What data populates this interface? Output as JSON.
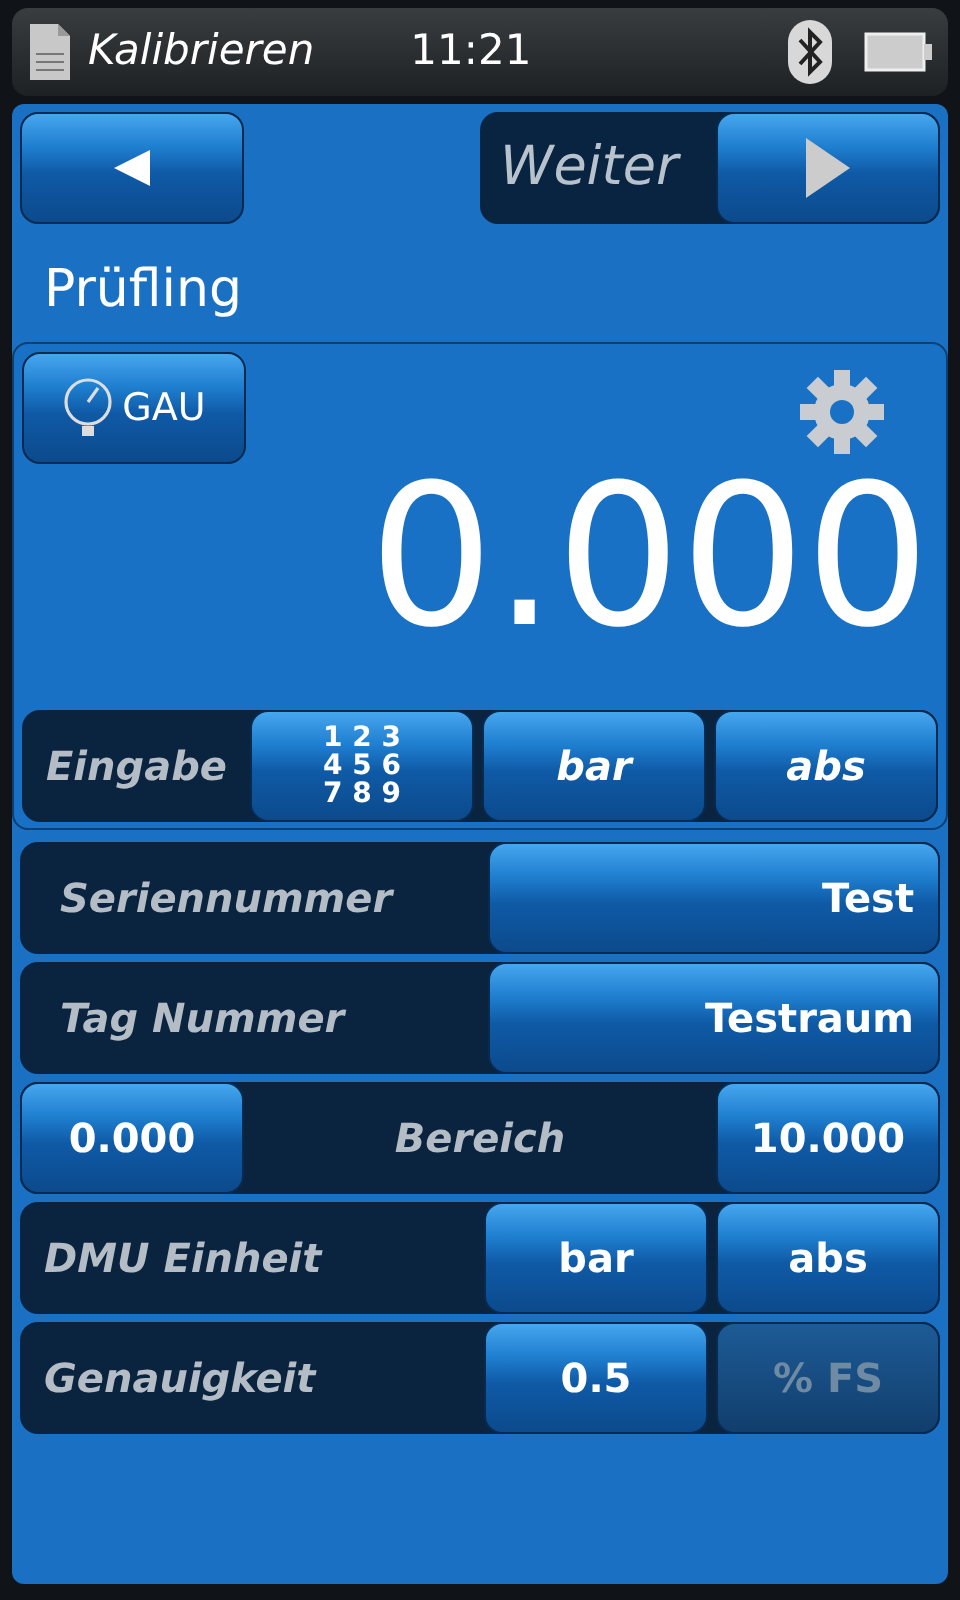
{
  "status_bar": {
    "app_title": "Kalibrieren",
    "time": "11:21"
  },
  "nav": {
    "next_label": "Weiter"
  },
  "section_title": "Prüfling",
  "reading": {
    "sensor_button": "GAU",
    "value": "0.000"
  },
  "input_row": {
    "label": "Eingabe",
    "keypad_lines": [
      "1 2 3",
      "4 5 6",
      "7 8 9"
    ],
    "unit": "bar",
    "mode": "abs"
  },
  "rows": [
    {
      "kind": "field",
      "label": "Seriennummer",
      "value": "Test"
    },
    {
      "kind": "field",
      "label": "Tag Nummer",
      "value": "Testraum"
    },
    {
      "kind": "range",
      "label": "Bereich",
      "low": "0.000",
      "high": "10.000"
    },
    {
      "kind": "pair",
      "label": "DMU Einheit",
      "buttons": [
        {
          "text": "bar",
          "disabled": false
        },
        {
          "text": "abs",
          "disabled": false
        }
      ]
    },
    {
      "kind": "pair",
      "label": "Genauigkeit",
      "buttons": [
        {
          "text": "0.5",
          "disabled": false
        },
        {
          "text": "% FS",
          "disabled": true
        }
      ]
    }
  ]
}
